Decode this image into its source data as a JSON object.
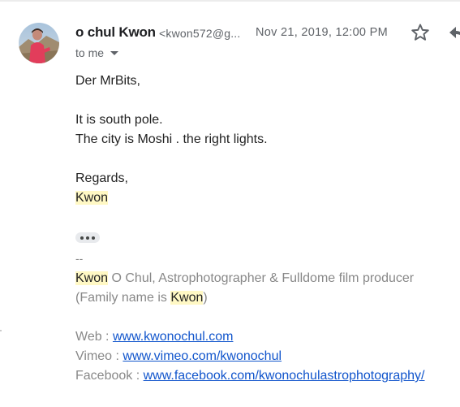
{
  "message": {
    "sender_name": "o chul Kwon",
    "sender_email": "<kwon572@g...",
    "timestamp": "Nov 21, 2019, 12:00 PM",
    "recipient": "to me",
    "body": {
      "greeting": "Der MrBits,",
      "line1": "It is south pole.",
      "line2": "The city is Moshi . the right lights.",
      "closing": "Regards,",
      "signoff": "Kwon"
    },
    "signature": {
      "separator": "--",
      "name_highlight": "Kwon",
      "title_rest": " O Chul, Astrophotographer & Fulldome film producer",
      "family_prefix": "(Family name is ",
      "family_highlight": "Kwon",
      "family_suffix": ")",
      "web_label": "Web : ",
      "web_link": "www.kwonochul.com",
      "vimeo_label": "Vimeo : ",
      "vimeo_link": "www.vimeo.com/kwonochul",
      "facebook_label": "Facebook : ",
      "facebook_link": "www.facebook.com/kwonochulastrophotography/"
    }
  },
  "icons": {
    "star": "star-outline-icon",
    "reply": "reply-icon",
    "caret": "caret-down-icon",
    "more": "ellipsis-icon"
  },
  "colors": {
    "highlight": "#fff8c4",
    "link": "#1155cc",
    "muted": "#5f6368",
    "signature_text": "#888888"
  }
}
